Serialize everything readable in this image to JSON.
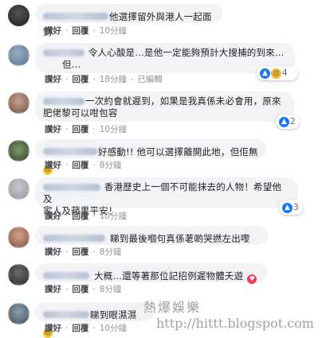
{
  "actions": {
    "like": "讚好",
    "reply": "回覆",
    "edited": "已編輯"
  },
  "comments": [
    {
      "text": "他選擇留外與港人一起面對",
      "time": "10分鐘"
    },
    {
      "line1": "令人心酸是…是他一定能夠預計大搜捕的到來…",
      "line2": "但…",
      "time": "18分鐘",
      "reaction_count": "4"
    },
    {
      "line1": "一次約會就遲到，如果是我真係未必會用，原來",
      "line2": "肥佬黎可以咁包容",
      "time": "10分鐘",
      "reaction_count": "2"
    },
    {
      "text": "好感動!! 他可以選擇離開此地，但佢無",
      "time": "8分鐘"
    },
    {
      "line1": "香港歷史上一個不可能抹去的人物！希望他及",
      "line2": "家人及蘋果平安！",
      "time": "10分鐘",
      "reaction_count": "3"
    },
    {
      "text": "睇到最後嗰句真係荖啲哭撚左出嚟",
      "time": "8分鐘"
    },
    {
      "text": "大概…還等著那位記招例遲物體夭遊",
      "time": "8分鐘"
    },
    {
      "text": "睇到眼濕濕",
      "time": "10分鐘"
    }
  ],
  "watermark": {
    "line1": "熱爆娛樂",
    "line2": "http://hittt.blogspot.com"
  },
  "colors": {
    "bubble": "#f2f3f5",
    "like_blue": "#1877f2",
    "meta_gray": "#90949c"
  }
}
